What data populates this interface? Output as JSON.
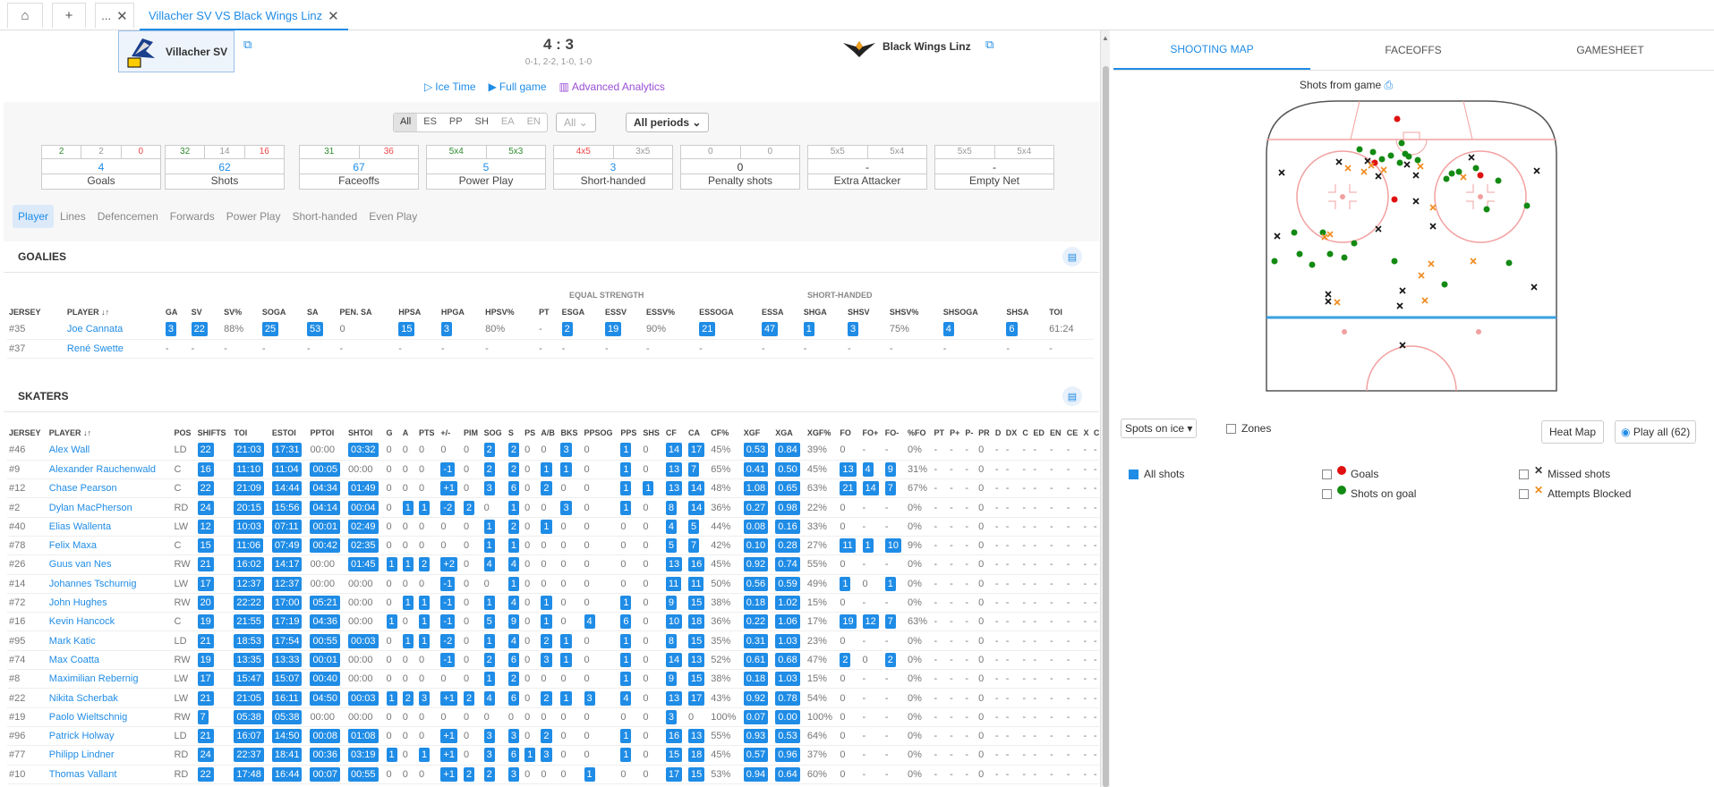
{
  "topbar": {
    "home_icon": "home-icon",
    "plus": "+",
    "dots": "...",
    "tab_title": "Villacher SV VS Black Wings Linz"
  },
  "game": {
    "home_team": "Villacher SV",
    "away_team": "Black Wings Linz",
    "score": "4 : 3",
    "periods": "0-1, 2-2, 1-0, 1-0",
    "links": [
      "Ice Time",
      "Full game",
      "Advanced Analytics"
    ]
  },
  "filters": {
    "strength": [
      "All",
      "ES",
      "PP",
      "SH",
      "EA",
      "EN"
    ],
    "all_select": "All",
    "periods_select": "All periods"
  },
  "statboxes": [
    {
      "a": "2",
      "b": "2",
      "c": "0",
      "total": "4",
      "label": "Goals"
    },
    {
      "a": "32",
      "b": "14",
      "c": "16",
      "total": "62",
      "label": "Shots"
    },
    {
      "a": "31",
      "b": "36",
      "total": "67",
      "label": "Faceoffs"
    },
    {
      "a": "5x4",
      "b": "5x3",
      "total": "5",
      "label": "Power Play"
    },
    {
      "a": "4x5",
      "b": "3x5",
      "total": "3",
      "label": "Short-handed"
    },
    {
      "a": "0",
      "b": "0",
      "total": "0",
      "label": "Penalty shots"
    },
    {
      "a": "5x5",
      "b": "5x4",
      "total": "-",
      "label": "Extra Attacker"
    },
    {
      "a": "5x5",
      "b": "5x4",
      "total": "-",
      "label": "Empty Net"
    }
  ],
  "subtabs": [
    "Player",
    "Lines",
    "Defencemen",
    "Forwards",
    "Power Play",
    "Short-handed",
    "Even Play"
  ],
  "goalies": {
    "title": "GOALIES",
    "group_es": "EQUAL STRENGTH",
    "group_sh": "SHORT-HANDED",
    "columns": [
      "JERSEY",
      "PLAYER ↓↑",
      "GA",
      "SV",
      "SV%",
      "SOGA",
      "SA",
      "PEN. SA",
      "HPSA",
      "HPGA",
      "HPSV%",
      "PT",
      "ESGA",
      "ESSV",
      "ESSV%",
      "ESSOGA",
      "ESSA",
      "SHGA",
      "SHSV",
      "SHSV%",
      "SHSOGA",
      "SHSA",
      "TOI"
    ],
    "rows": [
      [
        "#35",
        "Joe Cannata",
        "3",
        "22",
        "88%",
        "25",
        "53",
        "0",
        "15",
        "3",
        "80%",
        "-",
        "2",
        "19",
        "90%",
        "21",
        "47",
        "1",
        "3",
        "75%",
        "4",
        "6",
        "61:24"
      ],
      [
        "#37",
        "René Swette",
        "-",
        "-",
        "-",
        "-",
        "-",
        "-",
        "-",
        "-",
        "-",
        "-",
        "-",
        "-",
        "-",
        "-",
        "-",
        "-",
        "-",
        "-",
        "-",
        "-",
        "-"
      ]
    ]
  },
  "skaters": {
    "title": "SKATERS",
    "columns": [
      "JERSEY",
      "PLAYER ↓↑",
      "POS",
      "SHIFTS",
      "TOI",
      "ESTOI",
      "PPTOI",
      "SHTOI",
      "G",
      "A",
      "PTS",
      "+/-",
      "PIM",
      "SOG",
      "S",
      "PS",
      "A/B",
      "BKS",
      "PPSOG",
      "PPS",
      "SHS",
      "CF",
      "CA",
      "CF%",
      "XGF",
      "XGA",
      "XGF%",
      "FO",
      "FO+",
      "FO-",
      "%FO",
      "PT",
      "P+",
      "P-",
      "PR",
      "D",
      "DX",
      "C",
      "ED",
      "EN",
      "CE",
      "X",
      "C"
    ],
    "rows": [
      [
        "#46",
        "Alex Wall",
        "LD",
        "22",
        "21:03",
        "17:31",
        "00:00",
        "03:32",
        "0",
        "0",
        "0",
        "0",
        "0",
        "2",
        "2",
        "0",
        "0",
        "3",
        "0",
        "1",
        "0",
        "14",
        "17",
        "45%",
        "0.53",
        "0.84",
        "39%",
        "0",
        "-",
        "-",
        "0%",
        "-",
        "-",
        "-",
        "0",
        "-",
        "-",
        "-",
        "-",
        "-",
        "-",
        "-",
        "-"
      ],
      [
        "#9",
        "Alexander Rauchenwald",
        "C",
        "16",
        "11:10",
        "11:04",
        "00:05",
        "00:00",
        "0",
        "0",
        "0",
        "-1",
        "0",
        "2",
        "2",
        "0",
        "1",
        "1",
        "0",
        "1",
        "0",
        "13",
        "7",
        "65%",
        "0.41",
        "0.50",
        "45%",
        "13",
        "4",
        "9",
        "31%",
        "-",
        "-",
        "-",
        "0",
        "-",
        "-",
        "-",
        "-",
        "-",
        "-",
        "-",
        "-"
      ],
      [
        "#12",
        "Chase Pearson",
        "C",
        "22",
        "21:09",
        "14:44",
        "04:34",
        "01:49",
        "0",
        "0",
        "0",
        "+1",
        "0",
        "3",
        "6",
        "0",
        "2",
        "0",
        "0",
        "1",
        "1",
        "13",
        "14",
        "48%",
        "1.08",
        "0.65",
        "63%",
        "21",
        "14",
        "7",
        "67%",
        "-",
        "-",
        "-",
        "0",
        "-",
        "-",
        "-",
        "-",
        "-",
        "-",
        "-",
        "-"
      ],
      [
        "#2",
        "Dylan MacPherson",
        "RD",
        "24",
        "20:15",
        "15:56",
        "04:14",
        "00:04",
        "0",
        "1",
        "1",
        "-2",
        "2",
        "0",
        "1",
        "0",
        "0",
        "3",
        "0",
        "1",
        "0",
        "8",
        "14",
        "36%",
        "0.27",
        "0.98",
        "22%",
        "0",
        "-",
        "-",
        "0%",
        "-",
        "-",
        "-",
        "0",
        "-",
        "-",
        "-",
        "-",
        "-",
        "-",
        "-",
        "-"
      ],
      [
        "#40",
        "Elias Wallenta",
        "LW",
        "12",
        "10:03",
        "07:11",
        "00:01",
        "02:49",
        "0",
        "0",
        "0",
        "0",
        "0",
        "1",
        "2",
        "0",
        "1",
        "0",
        "0",
        "0",
        "0",
        "4",
        "5",
        "44%",
        "0.08",
        "0.16",
        "33%",
        "0",
        "-",
        "-",
        "0%",
        "-",
        "-",
        "-",
        "0",
        "-",
        "-",
        "-",
        "-",
        "-",
        "-",
        "-",
        "-"
      ],
      [
        "#78",
        "Felix Maxa",
        "C",
        "15",
        "11:06",
        "07:49",
        "00:42",
        "02:35",
        "0",
        "0",
        "0",
        "0",
        "0",
        "1",
        "1",
        "0",
        "0",
        "0",
        "0",
        "0",
        "0",
        "5",
        "7",
        "42%",
        "0.10",
        "0.28",
        "27%",
        "11",
        "1",
        "10",
        "9%",
        "-",
        "-",
        "-",
        "0",
        "-",
        "-",
        "-",
        "-",
        "-",
        "-",
        "-",
        "-"
      ],
      [
        "#26",
        "Guus van Nes",
        "RW",
        "21",
        "16:02",
        "14:17",
        "00:00",
        "01:45",
        "1",
        "1",
        "2",
        "+2",
        "0",
        "4",
        "4",
        "0",
        "0",
        "0",
        "0",
        "0",
        "0",
        "13",
        "16",
        "45%",
        "0.92",
        "0.74",
        "55%",
        "0",
        "-",
        "-",
        "0%",
        "-",
        "-",
        "-",
        "0",
        "-",
        "-",
        "-",
        "-",
        "-",
        "-",
        "-",
        "-"
      ],
      [
        "#14",
        "Johannes Tschurnig",
        "LW",
        "17",
        "12:37",
        "12:37",
        "00:00",
        "00:00",
        "0",
        "0",
        "0",
        "-1",
        "0",
        "0",
        "1",
        "0",
        "0",
        "0",
        "0",
        "0",
        "0",
        "11",
        "11",
        "50%",
        "0.56",
        "0.59",
        "49%",
        "1",
        "0",
        "1",
        "0%",
        "-",
        "-",
        "-",
        "0",
        "-",
        "-",
        "-",
        "-",
        "-",
        "-",
        "-",
        "-"
      ],
      [
        "#72",
        "John Hughes",
        "RW",
        "20",
        "22:22",
        "17:00",
        "05:21",
        "00:00",
        "0",
        "1",
        "1",
        "-1",
        "0",
        "1",
        "4",
        "0",
        "1",
        "0",
        "0",
        "1",
        "0",
        "9",
        "15",
        "38%",
        "0.18",
        "1.02",
        "15%",
        "0",
        "-",
        "-",
        "0%",
        "-",
        "-",
        "-",
        "0",
        "-",
        "-",
        "-",
        "-",
        "-",
        "-",
        "-",
        "-"
      ],
      [
        "#16",
        "Kevin Hancock",
        "C",
        "19",
        "21:55",
        "17:19",
        "04:36",
        "00:00",
        "1",
        "0",
        "1",
        "-1",
        "0",
        "5",
        "9",
        "0",
        "1",
        "0",
        "4",
        "6",
        "0",
        "10",
        "18",
        "36%",
        "0.22",
        "1.06",
        "17%",
        "19",
        "12",
        "7",
        "63%",
        "-",
        "-",
        "-",
        "0",
        "-",
        "-",
        "-",
        "-",
        "-",
        "-",
        "-",
        "-"
      ],
      [
        "#95",
        "Mark Katic",
        "LD",
        "21",
        "18:53",
        "17:54",
        "00:55",
        "00:03",
        "0",
        "1",
        "1",
        "-2",
        "0",
        "1",
        "4",
        "0",
        "2",
        "1",
        "0",
        "1",
        "0",
        "8",
        "15",
        "35%",
        "0.31",
        "1.03",
        "23%",
        "0",
        "-",
        "-",
        "0%",
        "-",
        "-",
        "-",
        "0",
        "-",
        "-",
        "-",
        "-",
        "-",
        "-",
        "-",
        "-"
      ],
      [
        "#74",
        "Max Coatta",
        "RW",
        "19",
        "13:35",
        "13:33",
        "00:01",
        "00:00",
        "0",
        "0",
        "0",
        "-1",
        "0",
        "2",
        "6",
        "0",
        "3",
        "1",
        "0",
        "1",
        "0",
        "14",
        "13",
        "52%",
        "0.61",
        "0.68",
        "47%",
        "2",
        "0",
        "2",
        "0%",
        "-",
        "-",
        "-",
        "0",
        "-",
        "-",
        "-",
        "-",
        "-",
        "-",
        "-",
        "-"
      ],
      [
        "#8",
        "Maximilian Rebernig",
        "LW",
        "17",
        "15:47",
        "15:07",
        "00:40",
        "00:00",
        "0",
        "0",
        "0",
        "0",
        "0",
        "1",
        "2",
        "0",
        "0",
        "0",
        "0",
        "1",
        "0",
        "9",
        "15",
        "38%",
        "0.18",
        "1.03",
        "15%",
        "0",
        "-",
        "-",
        "0%",
        "-",
        "-",
        "-",
        "0",
        "-",
        "-",
        "-",
        "-",
        "-",
        "-",
        "-",
        "-"
      ],
      [
        "#22",
        "Nikita Scherbak",
        "LW",
        "21",
        "21:05",
        "16:11",
        "04:50",
        "00:03",
        "1",
        "2",
        "3",
        "+1",
        "2",
        "4",
        "6",
        "0",
        "2",
        "1",
        "3",
        "4",
        "0",
        "13",
        "17",
        "43%",
        "0.92",
        "0.78",
        "54%",
        "0",
        "-",
        "-",
        "0%",
        "-",
        "-",
        "-",
        "0",
        "-",
        "-",
        "-",
        "-",
        "-",
        "-",
        "-",
        "-"
      ],
      [
        "#19",
        "Paolo Wieltschnig",
        "RW",
        "7",
        "05:38",
        "05:38",
        "00:00",
        "00:00",
        "0",
        "0",
        "0",
        "0",
        "0",
        "0",
        "0",
        "0",
        "0",
        "0",
        "0",
        "0",
        "0",
        "3",
        "0",
        "100%",
        "0.07",
        "0.00",
        "100%",
        "0",
        "-",
        "-",
        "0%",
        "-",
        "-",
        "-",
        "0",
        "-",
        "-",
        "-",
        "-",
        "-",
        "-",
        "-",
        "-"
      ],
      [
        "#96",
        "Patrick Holway",
        "LD",
        "21",
        "16:07",
        "14:50",
        "00:08",
        "01:08",
        "0",
        "0",
        "0",
        "+1",
        "0",
        "3",
        "3",
        "0",
        "2",
        "0",
        "0",
        "1",
        "0",
        "16",
        "13",
        "55%",
        "0.93",
        "0.53",
        "64%",
        "0",
        "-",
        "-",
        "0%",
        "-",
        "-",
        "-",
        "0",
        "-",
        "-",
        "-",
        "-",
        "-",
        "-",
        "-",
        "-"
      ],
      [
        "#77",
        "Philipp Lindner",
        "RD",
        "24",
        "22:37",
        "18:41",
        "00:36",
        "03:19",
        "1",
        "0",
        "1",
        "+1",
        "0",
        "3",
        "6",
        "1",
        "3",
        "0",
        "0",
        "1",
        "0",
        "15",
        "18",
        "45%",
        "0.57",
        "0.96",
        "37%",
        "0",
        "-",
        "-",
        "0%",
        "-",
        "-",
        "-",
        "0",
        "-",
        "-",
        "-",
        "-",
        "-",
        "-",
        "-",
        "-"
      ],
      [
        "#10",
        "Thomas Vallant",
        "RD",
        "22",
        "17:48",
        "16:44",
        "00:07",
        "00:55",
        "0",
        "0",
        "0",
        "+1",
        "2",
        "2",
        "3",
        "0",
        "0",
        "0",
        "1",
        "0",
        "0",
        "17",
        "15",
        "53%",
        "0.94",
        "0.64",
        "60%",
        "0",
        "-",
        "-",
        "0%",
        "-",
        "-",
        "-",
        "0",
        "-",
        "-",
        "-",
        "-",
        "-",
        "-",
        "-",
        "-"
      ]
    ]
  },
  "right": {
    "tabs": [
      "SHOOTING MAP",
      "FACEOFFS",
      "GAMESHEET"
    ],
    "shots_title": "Shots from game",
    "spots_select": "Spots on ice",
    "zones_label": "Zones",
    "heatmap_label": "Heat Map",
    "playall_label": "Play all (62)",
    "legend": {
      "all": "All shots",
      "goals": "Goals",
      "sog": "Shots on goal",
      "missed": "Missed shots",
      "blocked": "Attempts Blocked"
    },
    "colors": {
      "goal": "#e01010",
      "sog": "#138a13",
      "missed": "#111111",
      "blocked": "#f08a1c",
      "accent": "#1f8ce6",
      "rink_red": "#f2a0a0",
      "rink_blue": "#3aa0e0"
    }
  }
}
